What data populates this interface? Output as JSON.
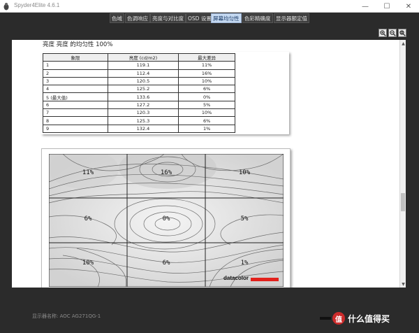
{
  "window": {
    "title": "Spyder4Elite 4.6.1",
    "minimize_glyph": "—",
    "maximize_glyph": "☐",
    "close_glyph": "✕"
  },
  "nav": {
    "tabs": [
      {
        "label": "色域",
        "active": false
      },
      {
        "label": "色调响应",
        "active": false
      },
      {
        "label": "亮度与对比度",
        "active": false
      },
      {
        "label": "OSD 设置",
        "active": false
      },
      {
        "label": "屏幕均匀性",
        "active": true
      },
      {
        "label": "色彩精确度",
        "active": false
      },
      {
        "label": "显示器额定值",
        "active": false
      }
    ]
  },
  "toolbar": {
    "zoom_in_icon": "zoom-in-icon",
    "zoom_out_icon": "zoom-out-icon",
    "zoom_fit_icon": "zoom-fit-icon"
  },
  "report": {
    "heading": "亮度 亮度 的均匀性 100%",
    "table": {
      "headers": [
        "象限",
        "亮度 (cd/m2)",
        "最大差异"
      ],
      "rows": [
        [
          "1",
          "119.1",
          "11%"
        ],
        [
          "2",
          "112.4",
          "16%"
        ],
        [
          "3",
          "120.5",
          "10%"
        ],
        [
          "4",
          "125.2",
          "6%"
        ],
        [
          "5 (最大值)",
          "133.6",
          "0%"
        ],
        [
          "6",
          "127.2",
          "5%"
        ],
        [
          "7",
          "120.3",
          "10%"
        ],
        [
          "8",
          "125.3",
          "6%"
        ],
        [
          "9",
          "132.4",
          "1%"
        ]
      ]
    },
    "uniformity_map": {
      "cells": [
        "11%",
        "16%",
        "10%",
        "6%",
        "0%",
        "5%",
        "10%",
        "6%",
        "1%"
      ],
      "background_color": "#d9d9d9",
      "contour_color": "#6b6b6b"
    },
    "brand": "datacolor",
    "brand_color": "#e2211c"
  },
  "status": {
    "monitor_name": "显示器名称: AOC AG271QG-1"
  },
  "watermark": {
    "badge": "值",
    "text": "什么值得买"
  }
}
